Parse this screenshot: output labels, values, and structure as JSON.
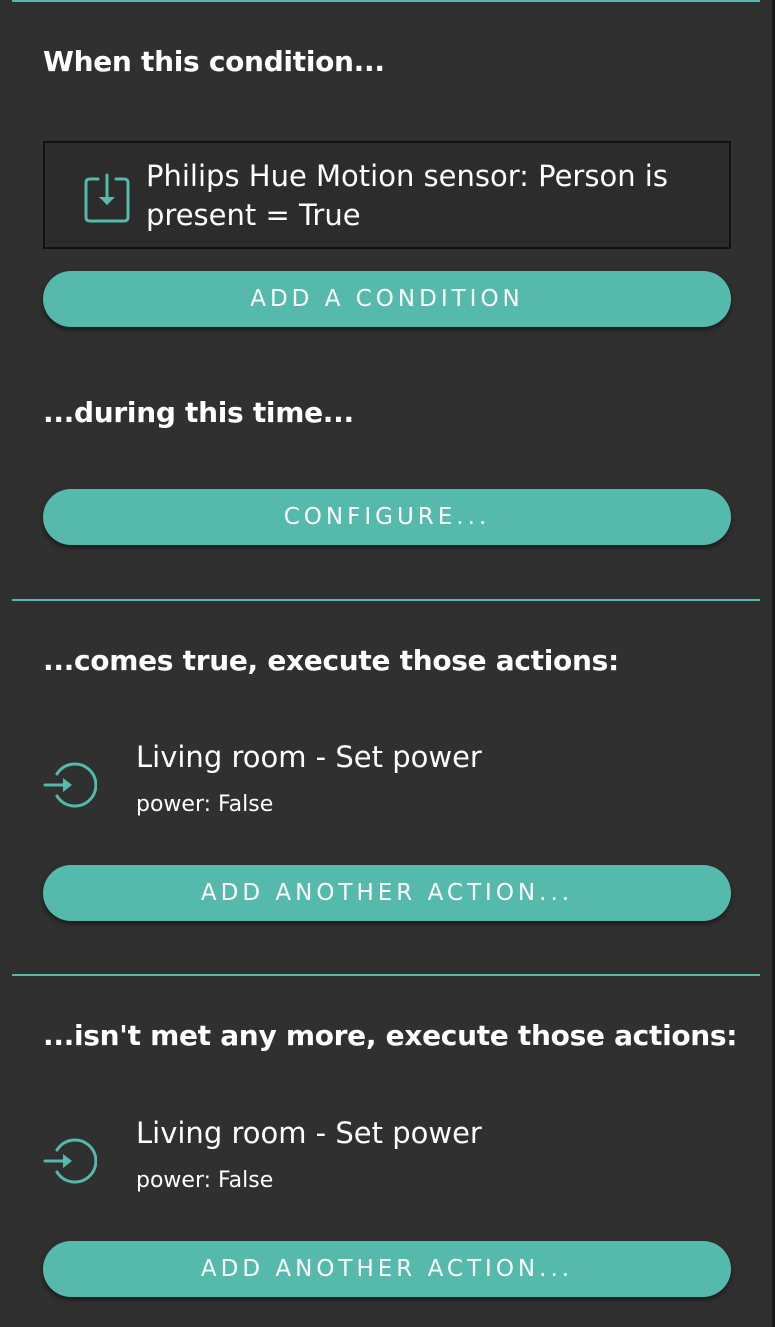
{
  "trigger": {
    "heading": "When this condition...",
    "condition_text": "Philips Hue Motion sensor: Person is present = True",
    "add_condition_label": "ADD A CONDITION",
    "condition_icon": "property-input-icon"
  },
  "timing": {
    "heading": "...during this time...",
    "configure_label": "CONFIGURE..."
  },
  "on_true": {
    "heading": "...comes true, execute those actions:",
    "actions": [
      {
        "title": "Living room - Set power",
        "detail": "power: False",
        "icon": "action-enter-icon"
      }
    ],
    "add_action_label": "ADD ANOTHER ACTION..."
  },
  "on_false": {
    "heading": "...isn't met any more, execute those actions:",
    "actions": [
      {
        "title": "Living room - Set power",
        "detail": "power: False",
        "icon": "action-enter-icon"
      }
    ],
    "add_action_label": "ADD ANOTHER ACTION..."
  },
  "colors": {
    "accent": "#55b9ac",
    "panel_background": "#303030",
    "text": "#ffffff"
  }
}
